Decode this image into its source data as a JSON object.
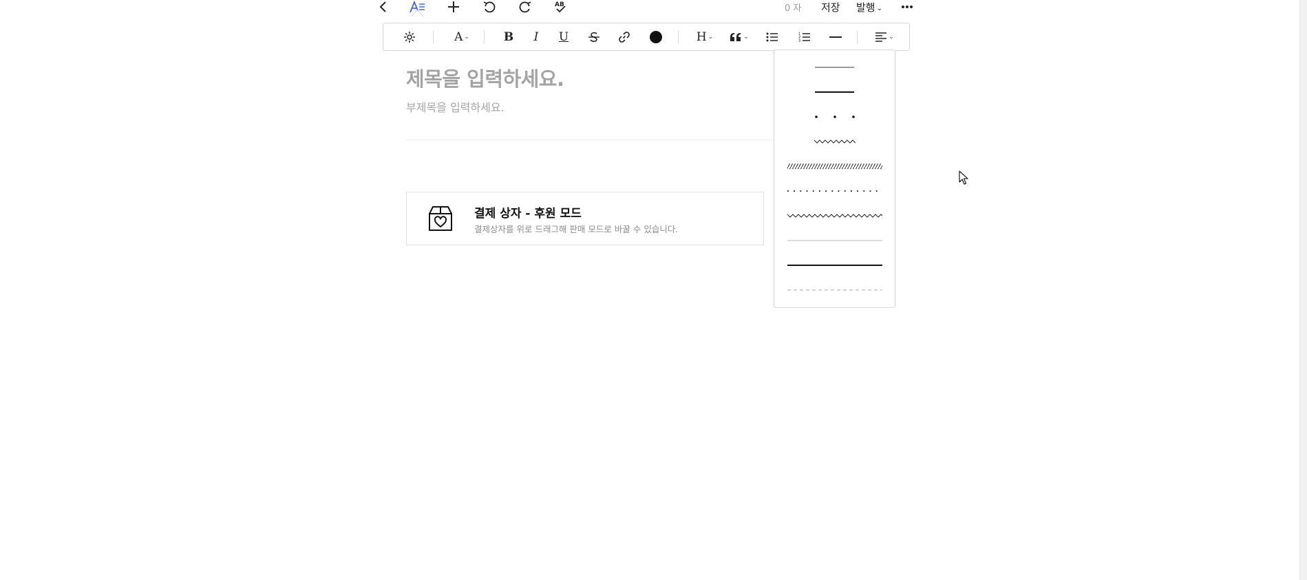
{
  "topbar": {
    "char_count": "0 자",
    "save_label": "저장",
    "publish_label": "발행",
    "icons": [
      "back-arrow-icon",
      "text-style-icon",
      "add-icon",
      "undo-icon",
      "redo-icon",
      "spellcheck-icon",
      "more-icon"
    ],
    "active_color": "#3f6bdc"
  },
  "toolbar": {
    "font_label": "A",
    "heading_label": "H",
    "bold_label": "B",
    "italic_label": "I",
    "underline_label": "U",
    "color_swatch": "#111111"
  },
  "editor": {
    "title_placeholder": "제목을 입력하세요.",
    "subtitle_placeholder": "부제목을 입력하세요."
  },
  "paybox": {
    "title": "결제 상자 - 후원 모드",
    "description": "결제상자를 위로 드래그해 판매 모드로 바꿀 수 있습니다."
  },
  "divider_menu": {
    "options": [
      "short-thin-line",
      "short-thick-line",
      "spaced-dots",
      "short-zigzag",
      "hatched-band",
      "dotted-line",
      "long-zigzag",
      "long-thin-line",
      "long-thick-line",
      "dashed-line"
    ]
  }
}
